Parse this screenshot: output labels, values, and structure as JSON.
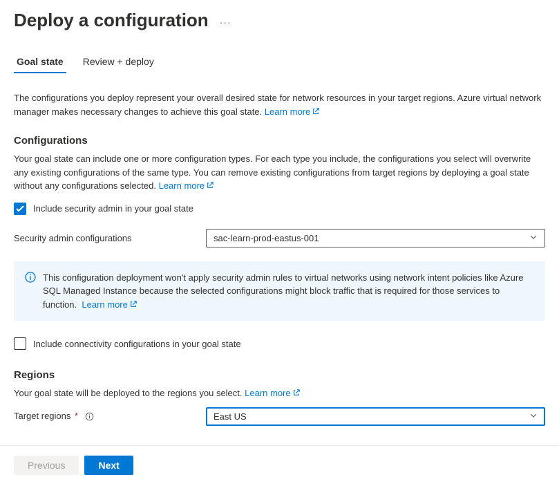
{
  "title": "Deploy a configuration",
  "tabs": [
    {
      "label": "Goal state"
    },
    {
      "label": "Review + deploy"
    }
  ],
  "intro": {
    "text": "The configurations you deploy represent your overall desired state for network resources in your target regions. Azure virtual network manager makes necessary changes to achieve this goal state.",
    "learn_more": "Learn more"
  },
  "configurations": {
    "heading": "Configurations",
    "desc": "Your goal state can include one or more configuration types. For each type you include, the configurations you select will overwrite any existing configurations of the same type. You can remove existing configurations from target regions by deploying a goal state without any configurations selected.",
    "learn_more": "Learn more",
    "include_security_label": "Include security admin in your goal state",
    "security_field_label": "Security admin configurations",
    "security_value": "sac-learn-prod-eastus-001",
    "info_box": "This configuration deployment won't apply security admin rules to virtual networks using network intent policies like Azure SQL Managed Instance because the selected configurations might block traffic that is required for those services to function.",
    "info_learn_more": "Learn more",
    "include_connectivity_label": "Include connectivity configurations in your goal state"
  },
  "regions": {
    "heading": "Regions",
    "desc": "Your goal state will be deployed to the regions you select.",
    "learn_more": "Learn more",
    "target_label": "Target regions",
    "target_value": "East US"
  },
  "footer": {
    "previous": "Previous",
    "next": "Next"
  }
}
